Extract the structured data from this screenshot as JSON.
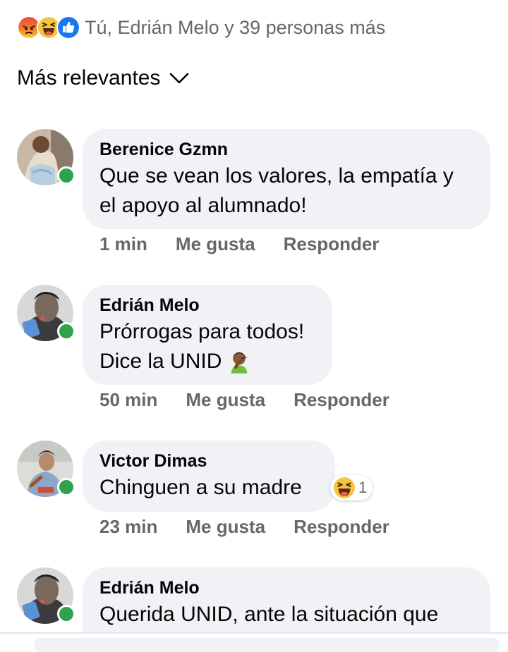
{
  "reactions": {
    "icons": [
      "angry-reaction-icon",
      "haha-reaction-icon",
      "like-reaction-icon"
    ],
    "summary": "Tú, Edrián Melo y 39 personas más"
  },
  "sort": {
    "label": "Más relevantes"
  },
  "comments": [
    {
      "author": "Berenice Gzmn",
      "lines": [
        "Que se vean los valores, la empatía y",
        "el apoyo al alumnado!"
      ],
      "time": "1 min",
      "like_label": "Me gusta",
      "reply_label": "Responder"
    },
    {
      "author": "Edrián Melo",
      "lines": [
        "Prórrogas para todos!",
        "Dice la UNID"
      ],
      "time": "50 min",
      "like_label": "Me gusta",
      "reply_label": "Responder"
    },
    {
      "author": "Victor Dimas",
      "lines": [
        "Chinguen a su madre"
      ],
      "time": "23 min",
      "like_label": "Me gusta",
      "reply_label": "Responder",
      "reaction_count": "1"
    },
    {
      "author": "Edrián Melo",
      "lines": [
        "Querida UNID, ante la situación que"
      ]
    }
  ],
  "colors": {
    "online": "#31a24c",
    "bubble": "#f0f2f5",
    "meta_text": "#65676b",
    "like_blue": "#1877f2"
  }
}
